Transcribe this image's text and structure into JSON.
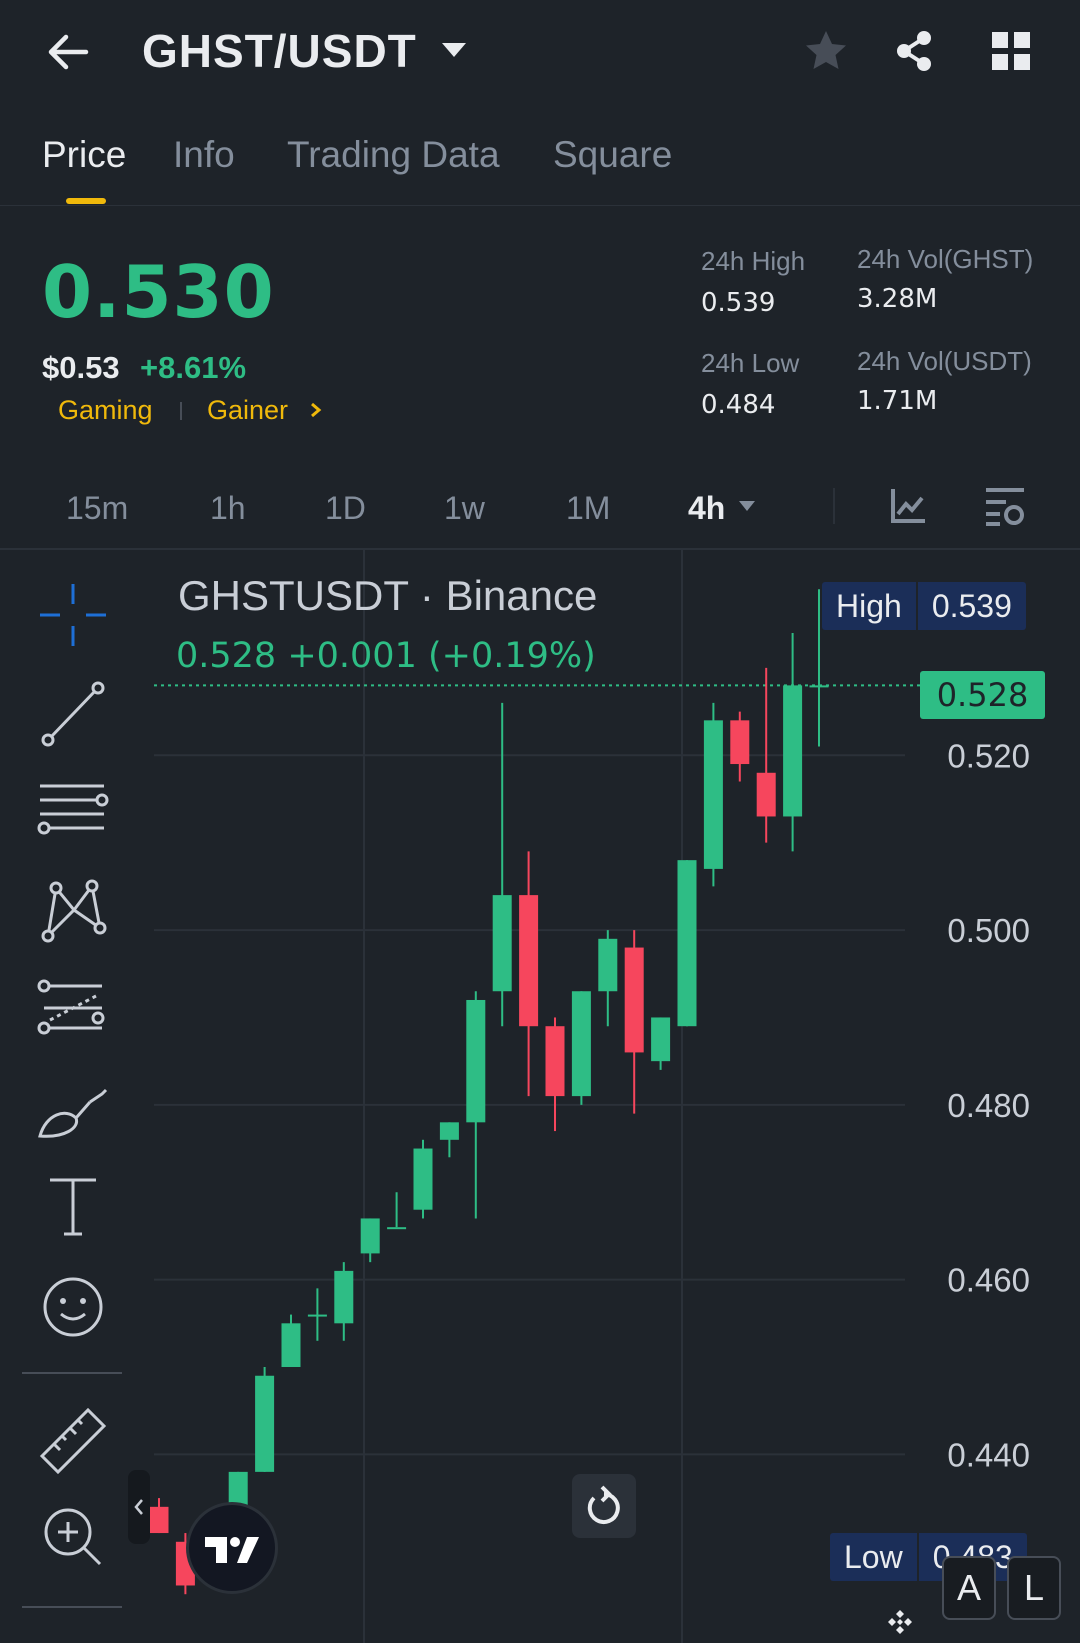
{
  "header": {
    "pair": "GHST/USDT"
  },
  "tabs": [
    {
      "label": "Price",
      "active": true
    },
    {
      "label": "Info",
      "active": false
    },
    {
      "label": "Trading Data",
      "active": false
    },
    {
      "label": "Square",
      "active": false
    }
  ],
  "price": {
    "last": "0.530",
    "usd": "$0.53",
    "change": "+8.61%",
    "tags": [
      "Gaming",
      "Gainer"
    ]
  },
  "stats": {
    "high_label": "24h High",
    "high_value": "0.539",
    "low_label": "24h Low",
    "low_value": "0.484",
    "vol_base_label": "24h Vol(GHST)",
    "vol_base_value": "3.28M",
    "vol_quote_label": "24h Vol(USDT)",
    "vol_quote_value": "1.71M"
  },
  "intervals": [
    "15m",
    "1h",
    "1D",
    "1w",
    "1M",
    "4h"
  ],
  "active_interval": "4h",
  "chart": {
    "symbol_title": "GHSTUSDT · Binance",
    "ohlc_summary": "0.528  +0.001 (+0.19%)",
    "high_label": "High",
    "high_value": "0.539",
    "last_tag": "0.528",
    "low_label": "Low",
    "low_value": "0.483",
    "up_color": "#2ebd85",
    "down_color": "#f6465d"
  },
  "chart_data": {
    "type": "candlestick",
    "y_ticks": [
      "0.520",
      "0.500",
      "0.480",
      "0.460",
      "0.440"
    ],
    "ylim": [
      0.427,
      0.538
    ],
    "candles": [
      {
        "o": 0.434,
        "h": 0.435,
        "l": 0.431,
        "c": 0.431
      },
      {
        "o": 0.43,
        "h": 0.431,
        "l": 0.424,
        "c": 0.425
      },
      {
        "o": 0.428,
        "h": 0.431,
        "l": 0.425,
        "c": 0.431
      },
      {
        "o": 0.43,
        "h": 0.438,
        "l": 0.429,
        "c": 0.438
      },
      {
        "o": 0.438,
        "h": 0.45,
        "l": 0.438,
        "c": 0.449
      },
      {
        "o": 0.45,
        "h": 0.456,
        "l": 0.45,
        "c": 0.455
      },
      {
        "o": 0.456,
        "h": 0.459,
        "l": 0.453,
        "c": 0.456
      },
      {
        "o": 0.455,
        "h": 0.462,
        "l": 0.453,
        "c": 0.461
      },
      {
        "o": 0.463,
        "h": 0.467,
        "l": 0.462,
        "c": 0.467
      },
      {
        "o": 0.466,
        "h": 0.47,
        "l": 0.466,
        "c": 0.466
      },
      {
        "o": 0.468,
        "h": 0.476,
        "l": 0.467,
        "c": 0.475
      },
      {
        "o": 0.476,
        "h": 0.478,
        "l": 0.474,
        "c": 0.478
      },
      {
        "o": 0.478,
        "h": 0.493,
        "l": 0.467,
        "c": 0.492
      },
      {
        "o": 0.493,
        "h": 0.526,
        "l": 0.489,
        "c": 0.504
      },
      {
        "o": 0.504,
        "h": 0.509,
        "l": 0.481,
        "c": 0.489
      },
      {
        "o": 0.489,
        "h": 0.49,
        "l": 0.477,
        "c": 0.481
      },
      {
        "o": 0.481,
        "h": 0.493,
        "l": 0.48,
        "c": 0.493
      },
      {
        "o": 0.493,
        "h": 0.5,
        "l": 0.489,
        "c": 0.499
      },
      {
        "o": 0.498,
        "h": 0.5,
        "l": 0.479,
        "c": 0.486
      },
      {
        "o": 0.485,
        "h": 0.49,
        "l": 0.484,
        "c": 0.49
      },
      {
        "o": 0.489,
        "h": 0.508,
        "l": 0.489,
        "c": 0.508
      },
      {
        "o": 0.507,
        "h": 0.526,
        "l": 0.505,
        "c": 0.524
      },
      {
        "o": 0.524,
        "h": 0.525,
        "l": 0.517,
        "c": 0.519
      },
      {
        "o": 0.518,
        "h": 0.53,
        "l": 0.51,
        "c": 0.513
      },
      {
        "o": 0.513,
        "h": 0.534,
        "l": 0.509,
        "c": 0.528
      },
      {
        "o": 0.528,
        "h": 0.539,
        "l": 0.521,
        "c": 0.528
      }
    ]
  }
}
